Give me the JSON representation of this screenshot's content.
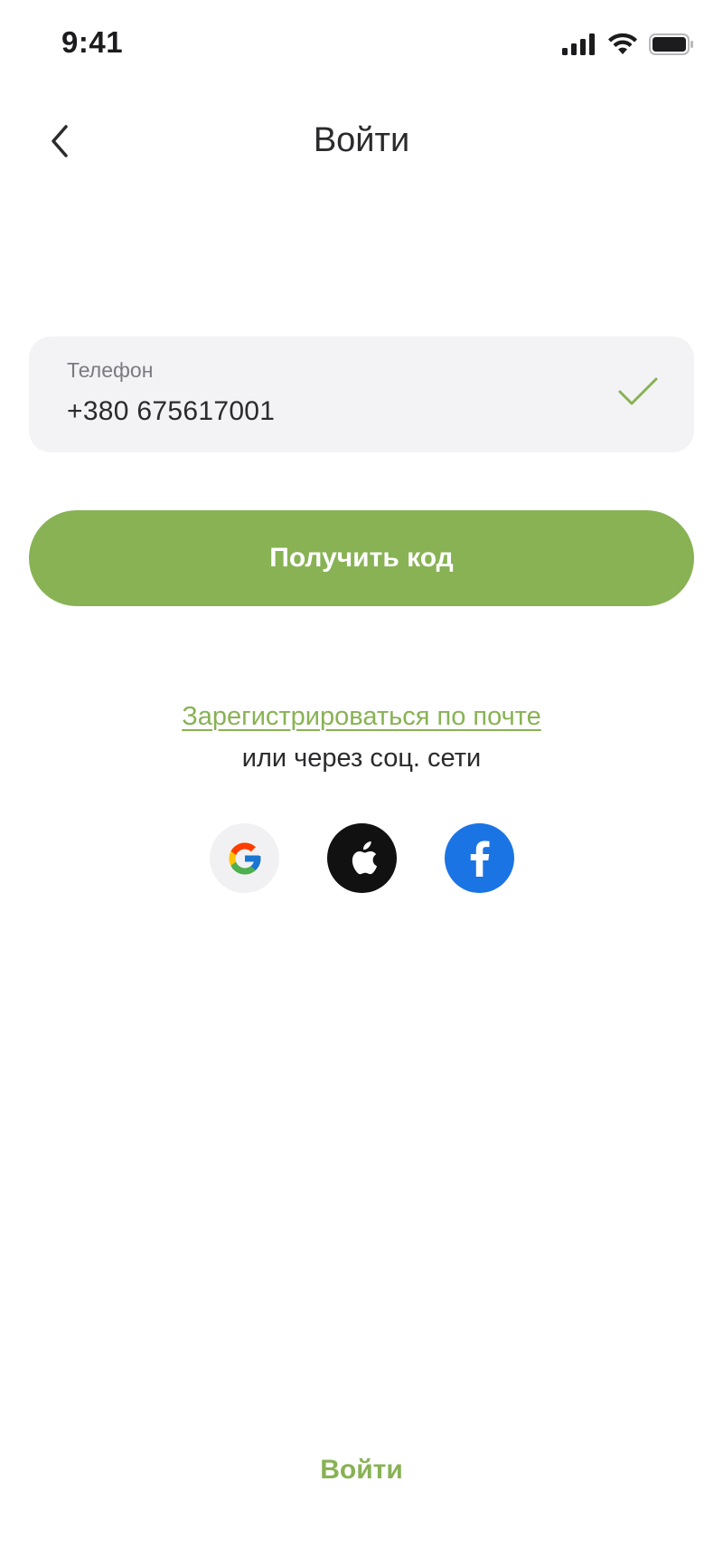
{
  "status_bar": {
    "time": "9:41"
  },
  "nav": {
    "title": "Войти"
  },
  "phone": {
    "label": "Телефон",
    "value": "+380 675617001"
  },
  "primary_button": {
    "label": "Получить код"
  },
  "register": {
    "link": "Зарегистрироваться по почте",
    "caption": "или через соц. сети"
  },
  "social": {
    "icons": [
      "google-icon",
      "apple-icon",
      "facebook-icon"
    ]
  },
  "bottom": {
    "login_label": "Войти"
  },
  "colors": {
    "accent": "#88b254",
    "field_bg": "#f3f3f5",
    "facebook": "#1b74e4",
    "apple": "#111111"
  }
}
